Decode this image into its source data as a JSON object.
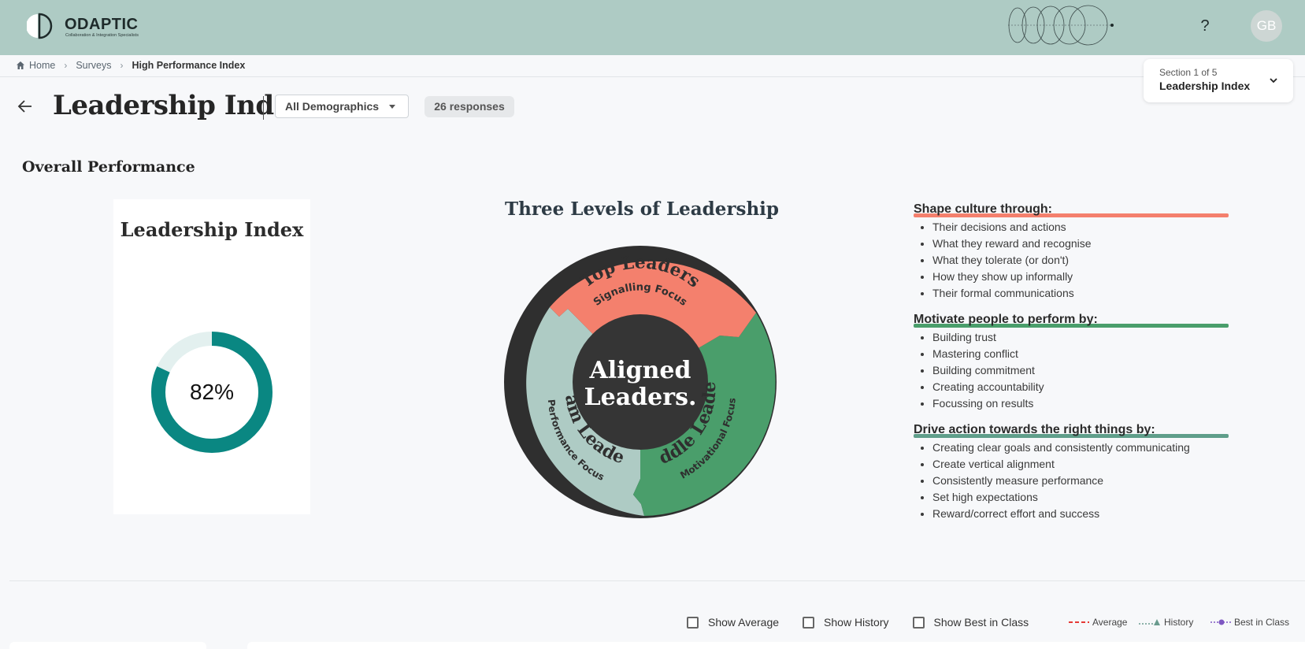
{
  "header": {
    "logo_text": "ODAPTIC",
    "logo_tagline": "Collaboration & Integration Specialists",
    "help_label": "?",
    "avatar_initials": "GB"
  },
  "breadcrumb": {
    "home": "Home",
    "surveys": "Surveys",
    "current": "High Performance Index"
  },
  "section_selector": {
    "position": "Section 1 of 5",
    "name": "Leadership Index"
  },
  "title_row": {
    "title": "Leadership Index",
    "demographic": "All Demographics",
    "responses": "26 responses"
  },
  "overall": {
    "heading": "Overall Performance",
    "card_title": "Leadership Index",
    "score_label": "82%",
    "score_fraction": 0.82,
    "ring_color": "#0a8782",
    "track_color": "#e3f0ef"
  },
  "levels": {
    "title": "Three Levels of Leadership",
    "center_line1": "Aligned",
    "center_line2": "Leaders.",
    "top": {
      "name": "Top Leaders",
      "focus": "Signalling Focus",
      "color": "#f4806d"
    },
    "team": {
      "name": "Team Leaders",
      "focus": "Performance Focus",
      "color": "#aecbc4"
    },
    "middle": {
      "name": "Middle Leaders",
      "focus": "Motivational Focus",
      "color": "#4a9e6b"
    }
  },
  "lists": [
    {
      "heading": "Shape culture through:",
      "color": "#f4806d",
      "items": [
        "Their decisions and actions",
        "What they reward and recognise",
        "What they tolerate (or don't)",
        "How they show up informally",
        "Their formal communications"
      ]
    },
    {
      "heading": "Motivate people to perform by:",
      "color": "#4a9e6b",
      "items": [
        "Building trust",
        "Mastering conflict",
        "Building commitment",
        "Creating accountability",
        "Focussing on results"
      ]
    },
    {
      "heading": "Drive action towards the right things by:",
      "color": "#5f9e8a",
      "items": [
        "Creating clear goals and consistently communicating",
        "Create vertical alignment",
        "Consistently measure performance",
        "Set high expectations",
        "Reward/correct effort and success"
      ]
    }
  ],
  "controls": {
    "show_average": "Show Average",
    "show_history": "Show History",
    "show_best": "Show Best in Class"
  },
  "legend": {
    "average": "Average",
    "history": "History",
    "best": "Best in Class",
    "average_color": "#e53935",
    "history_color": "#6a9b8e",
    "best_color": "#7e57c2"
  }
}
